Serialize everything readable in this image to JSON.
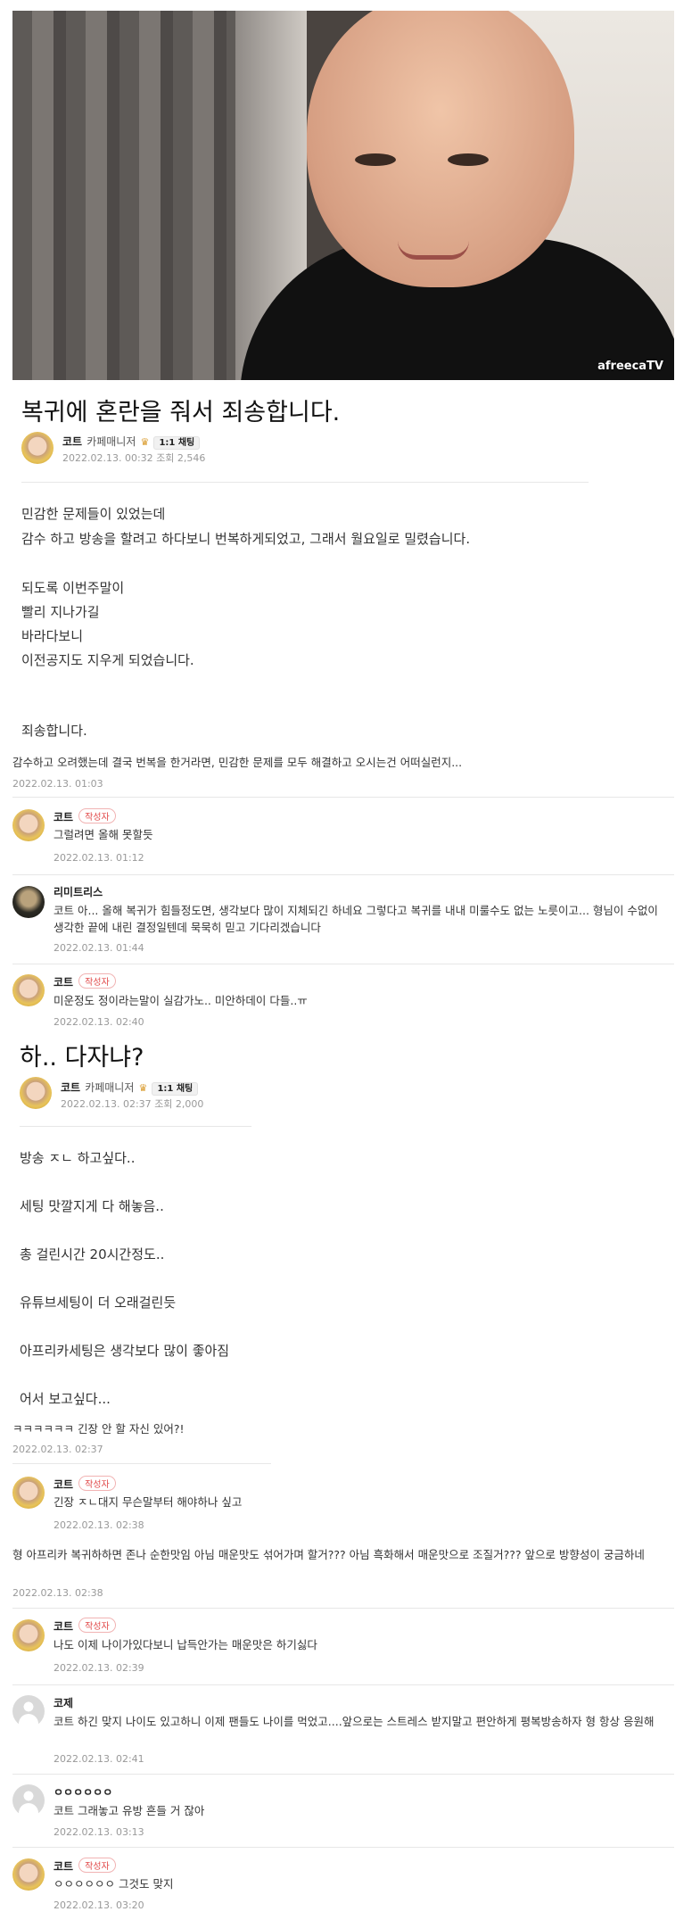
{
  "photo": {
    "watermark": "afreecaTV"
  },
  "post1": {
    "title": "복귀에 혼란을 줘서 죄송합니다.",
    "author": "코트",
    "role": "카페매니저",
    "chat": "1:1 채팅",
    "date": "2022.02.13. 00:32",
    "views": "조회 2,546",
    "body": [
      "민감한 문제들이 있었는데",
      "감수 하고 방송을 할려고 하다보니 번복하게되었고, 그래서 월요일로 밀렸습니다.",
      "되도록 이번주말이",
      "빨리 지나가길",
      "바라다보니",
      "이전공지도 지우게 되었습니다.",
      "죄송합니다."
    ],
    "comments": [
      {
        "nick": "",
        "badge": "",
        "text": "감수하고 오려했는데 결국 번복을 한거라면, 민감한 문제를 모두 해결하고 오시는건 어떠실런지...",
        "date": "2022.02.13. 01:03"
      },
      {
        "nick": "코트",
        "badge": "작성자",
        "text": "그럴려면 올해 못할듯",
        "date": "2022.02.13. 01:12"
      },
      {
        "nick": "리미트리스",
        "badge": "",
        "text": "코트 아... 올해 복귀가 힘들정도면, 생각보다 많이 지체되긴 하네요 그렇다고 복귀를 내내 미룰수도 없는 노릇이고... 형님이 수없이 생각한 끝에 내린 결정일텐데 묵묵히 믿고 기다리겠습니다",
        "date": "2022.02.13. 01:44"
      },
      {
        "nick": "코트",
        "badge": "작성자",
        "text": "미운정도 정이라는말이 실감가노.. 미안하데이 다들..ㅠ",
        "date": "2022.02.13. 02:40"
      }
    ]
  },
  "post2": {
    "title": "하.. 다자냐?",
    "author": "코트",
    "role": "카페매니저",
    "chat": "1:1 채팅",
    "date": "2022.02.13. 02:37",
    "views": "조회 2,000",
    "body": [
      "방송 ㅈㄴ 하고싶다..",
      "세팅 맛깔지게 다 해놓음..",
      "총 걸린시간 20시간정도..",
      "유튜브세팅이 더 오래걸린듯",
      "아프리카세팅은 생각보다 많이 좋아짐",
      "어서 보고싶다..."
    ],
    "comments": [
      {
        "nick": "",
        "badge": "",
        "text": "ㅋㅋㅋㅋㅋㅋ 긴장 안 할 자신 있어?!",
        "date": "2022.02.13. 02:37"
      },
      {
        "nick": "코트",
        "badge": "작성자",
        "text": "긴장 ㅈㄴ대지 무슨말부터 해야하나 싶고",
        "date": "2022.02.13. 02:38"
      },
      {
        "nick": "",
        "badge": "",
        "text": "형 아프리카 복귀하하면 존나 순한맛임 아님 매운맛도 섞어가며 할거??? 아님 흑화해서 매운맛으로 조질거??? 앞으로 방향성이 궁금하네",
        "date": "2022.02.13. 02:38"
      },
      {
        "nick": "코트",
        "badge": "작성자",
        "text": "나도 이제 나이가있다보니 납득안가는 매운맛은 하기싫다",
        "date": "2022.02.13. 02:39"
      },
      {
        "nick": "코제",
        "badge": "",
        "text": "코트 하긴 맞지 나이도 있고하니 이제 팬들도 나이를 먹었고....앞으로는 스트레스 받지말고 편안하게 평복방송하자 형 항상 응원해",
        "date": "2022.02.13. 02:41"
      },
      {
        "nick": "ㅇㅇㅇㅇㅇㅇ",
        "badge": "",
        "text": "코트 그래놓고 유방 흔들 거 잖아",
        "date": "2022.02.13. 03:13"
      },
      {
        "nick": "코트",
        "badge": "작성자",
        "text": "ㅇㅇㅇㅇㅇㅇ 그것도 맞지",
        "date": "2022.02.13. 03:20"
      }
    ]
  }
}
